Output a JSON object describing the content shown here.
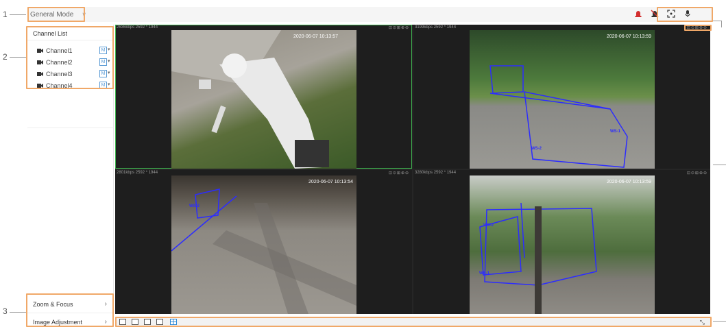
{
  "callouts": [
    "1",
    "2",
    "3"
  ],
  "topbar": {
    "mode_label": "General Mode",
    "mode_chevron": "∨",
    "icons": [
      "alarm-light-icon",
      "alarm-disabled-icon",
      "capture-icon",
      "microphone-icon"
    ],
    "icon_color": "#d32f2f"
  },
  "channel_list": {
    "title": "Channel List",
    "channels": [
      {
        "name": "Channel1",
        "stream": "M"
      },
      {
        "name": "Channel2",
        "stream": "M"
      },
      {
        "name": "Channel3",
        "stream": "M"
      },
      {
        "name": "Channel4",
        "stream": "M"
      }
    ]
  },
  "menu": {
    "zoom_focus": "Zoom & Focus",
    "image_adjustment": "Image Adjustment",
    "arrow": "›"
  },
  "panes": [
    {
      "info": "2636kbps 2592 * 1944",
      "tools": "⊡⊙⊞⊕⊖",
      "timestamp": "2020-06-07 10:13:57"
    },
    {
      "info": "3199kbps 2592 * 1944",
      "tools": "⊡⊙⊞⊕⊖",
      "timestamp": "2020-06-07 10:13:59"
    },
    {
      "info": "2801kbps 2592 * 1944",
      "tools": "⊡⊙⊞⊕⊖",
      "timestamp": "2020-06-07 10:13:54"
    },
    {
      "info": "3280kbps 2592 * 1944",
      "tools": "⊡⊙⊞⊕⊖",
      "timestamp": "2020-06-07 10:13:59"
    }
  ],
  "rule_labels": {
    "ws2": "WS-2",
    "ws1": "WS-1",
    "ws_b": "WS-2",
    "ws_c": "WS-1"
  },
  "bottombar": {
    "fullscreen_glyph": "⤡"
  },
  "colors": {
    "accent_box": "#f0a868",
    "selected_pane": "#3fb34f",
    "rule_lines": "#2c2cff",
    "stream_badge": "#5b9bd5"
  }
}
